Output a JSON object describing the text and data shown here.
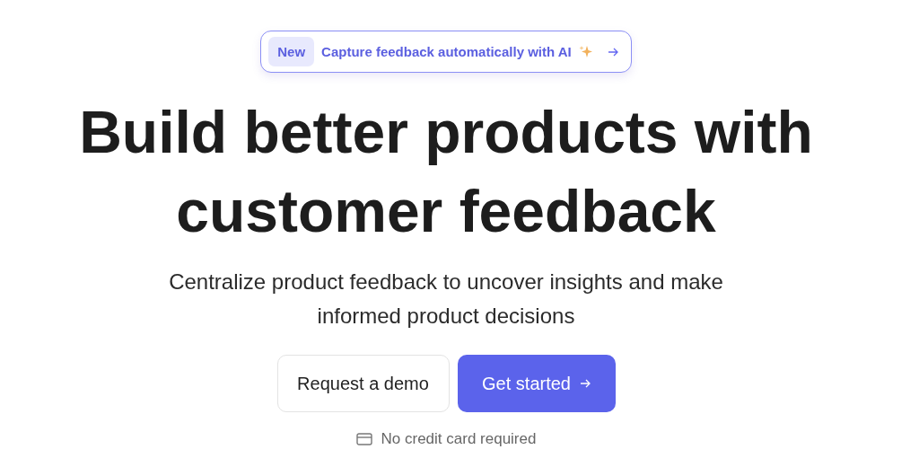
{
  "announcement": {
    "badge": "New",
    "text": "Capture feedback automatically with AI"
  },
  "heading": "Build better products with customer feedback",
  "subtitle": "Centralize product feedback to uncover insights and make informed product decisions",
  "buttons": [
    {
      "label": "Request a demo",
      "kind": "secondary"
    },
    {
      "label": "Get started",
      "kind": "primary"
    }
  ],
  "note": "No credit card required"
}
